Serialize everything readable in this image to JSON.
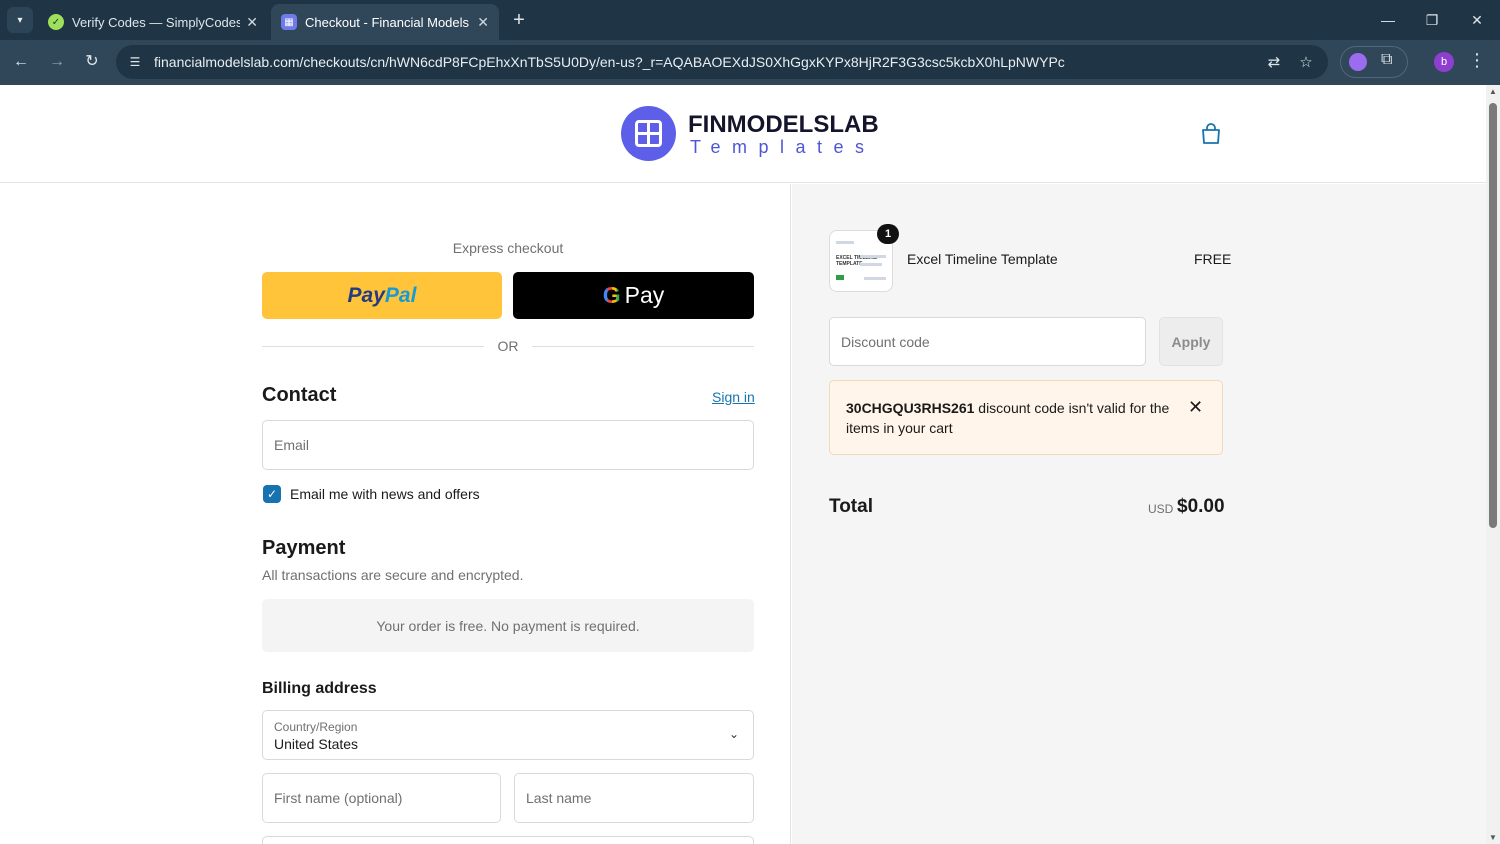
{
  "browser": {
    "tabs": [
      {
        "title": "Verify Codes — SimplyCodes",
        "active": false
      },
      {
        "title": "Checkout - Financial Models Lab",
        "active": true
      }
    ],
    "url": "financialmodelslab.com/checkouts/cn/hWN6cdP8FCpEhxXnTbS5U0Dy/en-us?_r=AQABAOEXdJS0XhGgxKYPx8HjR2F3G3csc5kcbX0hLpNWYPc",
    "profile_initial": "b"
  },
  "header": {
    "logo_name": "FINMODELSLAB",
    "logo_sub": "Templates"
  },
  "checkout": {
    "express_label": "Express checkout",
    "paypal_a": "Pay",
    "paypal_b": "Pal",
    "gpay_g": "G",
    "gpay_label": "Pay",
    "or_label": "OR",
    "contact_title": "Contact",
    "sign_in": "Sign in",
    "email_placeholder": "Email",
    "newsletter_label": "Email me with news and offers",
    "newsletter_checked": true,
    "payment_title": "Payment",
    "payment_sub": "All transactions are secure and encrypted.",
    "free_notice": "Your order is free. No payment is required.",
    "billing_title": "Billing address",
    "country_label": "Country/Region",
    "country_value": "United States",
    "first_name_placeholder": "First name (optional)",
    "last_name_placeholder": "Last name"
  },
  "summary": {
    "quantity": "1",
    "thumb_text_line1": "EXCEL TIMELINE",
    "thumb_text_line2": "TEMPLATE",
    "product_name": "Excel Timeline Template",
    "product_price": "FREE",
    "discount_placeholder": "Discount code",
    "apply_label": "Apply",
    "error_code": "30CHGQU3RHS261",
    "error_message": " discount code isn't valid for the items in your cart",
    "total_label": "Total",
    "currency": "USD",
    "total_amount": "$0.00"
  },
  "colors": {
    "brand": "#5d5fe8",
    "link": "#1773b0",
    "paypal": "#ffc439",
    "error_bg": "#fff5ea"
  }
}
